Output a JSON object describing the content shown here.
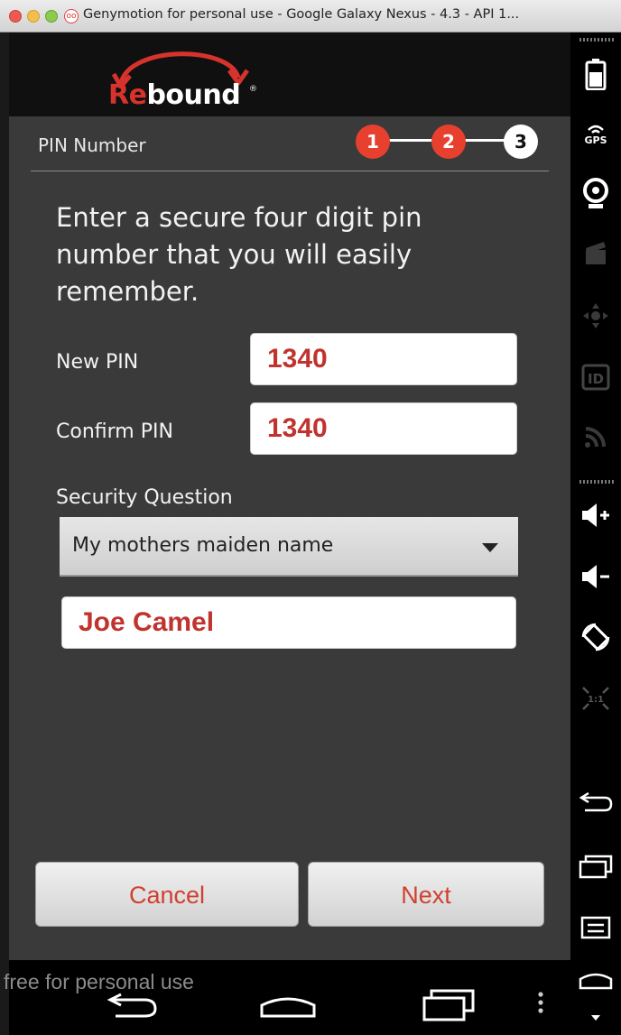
{
  "window": {
    "title": "Genymotion for personal use - Google Galaxy Nexus - 4.3 - API 1...",
    "app_icon_text": "oo"
  },
  "app": {
    "logo": {
      "part1": "Re",
      "part2": "bound",
      "reg": "®"
    },
    "screen_title": "PIN Number",
    "steps": [
      "1",
      "2",
      "3"
    ],
    "current_step": 3,
    "instructions": "Enter a secure four digit pin number that you will easily remember.",
    "new_pin": {
      "label": "New PIN",
      "value": "1340"
    },
    "confirm_pin": {
      "label": "Confirm PIN",
      "value": "1340"
    },
    "security_question": {
      "label": "Security Question",
      "selected": "My mothers maiden name",
      "answer": "Joe Camel"
    },
    "buttons": {
      "cancel": "Cancel",
      "next": "Next"
    }
  },
  "watermark": "free for personal use",
  "toolbar": {
    "gps_label": "GPS",
    "id_label": "ID",
    "pixel_label": "1:1"
  },
  "colors": {
    "accent_red": "#d6332c",
    "field_text": "#c0332e",
    "button_text": "#d0402f"
  }
}
